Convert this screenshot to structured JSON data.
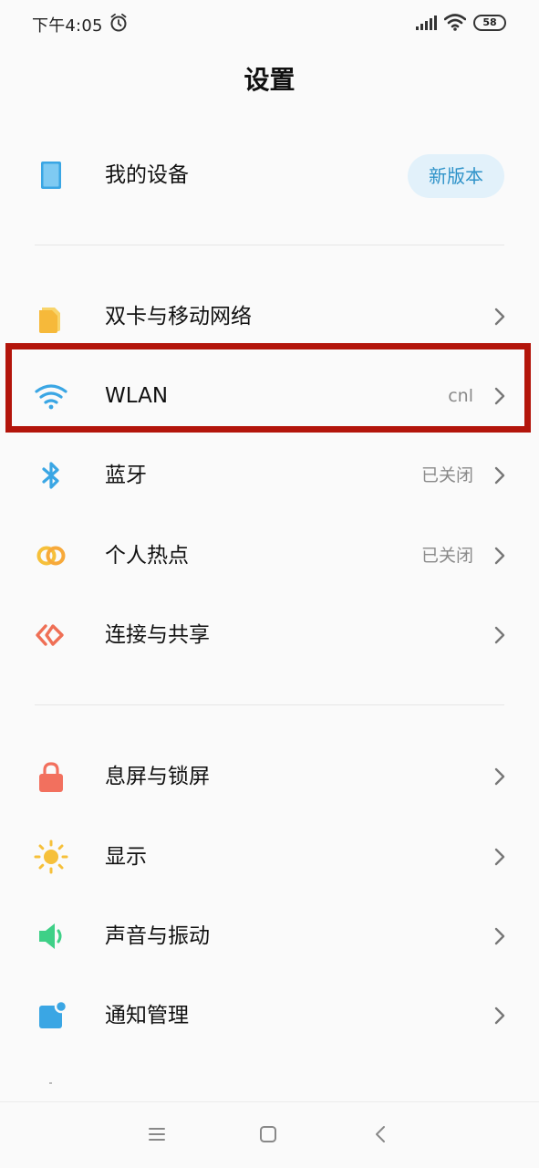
{
  "status_bar": {
    "time": "下午4:05",
    "battery": "58",
    "icons": [
      "alarm-icon",
      "signal-icon",
      "wifi-icon",
      "battery-icon"
    ]
  },
  "header": {
    "title": "设置"
  },
  "my_device": {
    "label": "我的设备",
    "badge": "新版本",
    "icon": "tablet-icon"
  },
  "network_items": [
    {
      "label": "双卡与移动网络",
      "value": "",
      "icon": "sim-card-icon",
      "color": "#f6c03a"
    },
    {
      "label": "WLAN",
      "value": "cnl",
      "icon": "wifi-icon",
      "color": "#3aa6e4"
    },
    {
      "label": "蓝牙",
      "value": "已关闭",
      "icon": "bluetooth-icon",
      "color": "#3aa6e4"
    },
    {
      "label": "个人热点",
      "value": "已关闭",
      "icon": "hotspot-icon",
      "color": "#f6c03a"
    },
    {
      "label": "连接与共享",
      "value": "",
      "icon": "share-icon",
      "color": "#ef6f55"
    }
  ],
  "display_items": [
    {
      "label": "息屏与锁屏",
      "icon": "lock-icon",
      "color": "#f2705e"
    },
    {
      "label": "显示",
      "icon": "sun-icon",
      "color": "#f6c03a"
    },
    {
      "label": "声音与振动",
      "icon": "speaker-icon",
      "color": "#3ed087"
    },
    {
      "label": "通知管理",
      "icon": "notification-icon",
      "color": "#3aa6e4"
    }
  ],
  "nav_bar": {
    "buttons": [
      "menu-icon",
      "home-icon",
      "back-icon"
    ]
  }
}
